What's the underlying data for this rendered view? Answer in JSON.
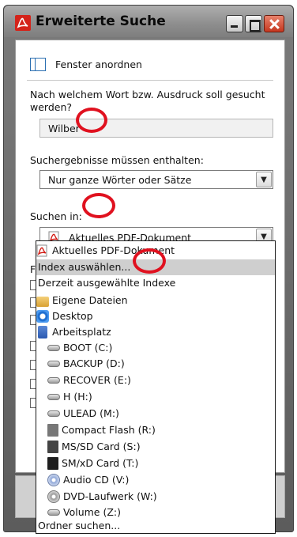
{
  "window": {
    "title": "Erweiterte Suche"
  },
  "arrange": {
    "label": "Fenster anordnen"
  },
  "search": {
    "question": "Nach welchem Wort bzw. Ausdruck soll gesucht werden?",
    "value": "Wilber"
  },
  "results": {
    "label": "Suchergebnisse müssen enthalten:",
    "selected": "Nur ganze Wörter oder Sätze"
  },
  "scope": {
    "label": "Suchen in:",
    "selected": "Aktuelles PDF-Dokument",
    "partial_label": "Fo"
  },
  "dropdown": {
    "items": [
      {
        "label": "Aktuelles PDF-Dokument",
        "icon": "pdf-icon"
      },
      {
        "label": "Index auswählen...",
        "icon": "",
        "selected": true
      },
      {
        "label": "Derzeit ausgewählte Indexe",
        "icon": ""
      },
      {
        "label": "Eigene Dateien",
        "icon": "folder-icon"
      },
      {
        "label": "Desktop",
        "icon": "desktop-icon"
      },
      {
        "label": "Arbeitsplatz",
        "icon": "computer-icon"
      },
      {
        "label": "BOOT (C:)",
        "icon": "drive-icon"
      },
      {
        "label": "BACKUP (D:)",
        "icon": "drive-icon"
      },
      {
        "label": "RECOVER (E:)",
        "icon": "drive-icon"
      },
      {
        "label": "H (H:)",
        "icon": "drive-icon"
      },
      {
        "label": "ULEAD (M:)",
        "icon": "drive-icon"
      },
      {
        "label": "Compact Flash (R:)",
        "icon": "compact-flash-icon"
      },
      {
        "label": "MS/SD Card (S:)",
        "icon": "sd-card-icon"
      },
      {
        "label": "SM/xD Card (T:)",
        "icon": "sm-card-icon"
      },
      {
        "label": "Audio CD (V:)",
        "icon": "audio-cd-icon"
      },
      {
        "label": "DVD-Laufwerk (W:)",
        "icon": "dvd-drive-icon"
      },
      {
        "label": "Volume (Z:)",
        "icon": "drive-icon"
      },
      {
        "label": "Ordner suchen...",
        "icon": ""
      }
    ]
  },
  "colors": {
    "annotation": "#e0111f",
    "selection": "#cfcfcf"
  }
}
